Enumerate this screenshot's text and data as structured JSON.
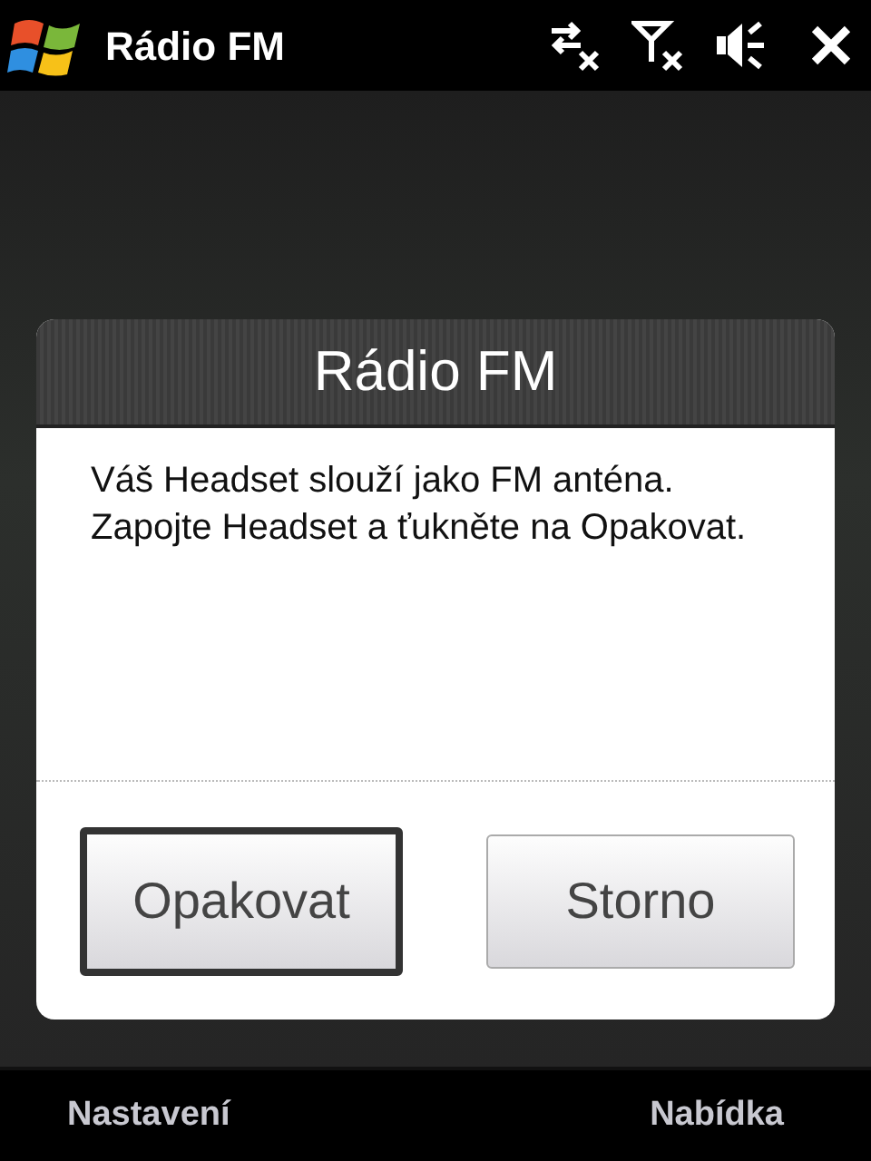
{
  "window": {
    "title": "Rádio FM"
  },
  "dialog": {
    "title": "Rádio FM",
    "message": "Váš Headset slouží jako FM anténa. Zapojte Headset a ťukněte na Opakovat.",
    "buttons": [
      {
        "label": "Opakovat",
        "selected": true
      },
      {
        "label": "Storno",
        "selected": false
      }
    ]
  },
  "softkeys": [
    "Nastavení",
    "Nabídka"
  ]
}
